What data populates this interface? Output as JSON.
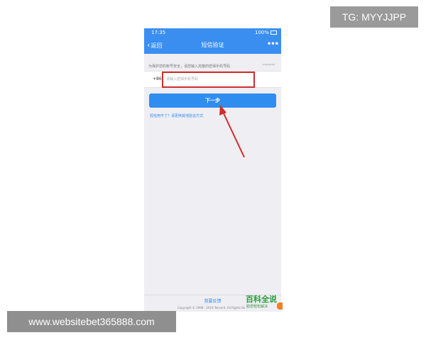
{
  "status_bar": {
    "time": "17:35",
    "right_text": "100%"
  },
  "nav": {
    "back_label": "返回",
    "title": "短信验证",
    "more_label": "•••"
  },
  "tip": {
    "text": "为保护您的帐号安全，请您输入完整的密保手机号码",
    "masked": "*******"
  },
  "phone_row": {
    "country_code": "+86",
    "placeholder": "请输入密保手机号码"
  },
  "next_button": {
    "label": "下一步"
  },
  "alt_link": {
    "label": "短信用不了？请更换其他验证方式"
  },
  "footer": {
    "feedback": "我要反馈",
    "copyright": "Copyright © 1998 - 2019 Tencent. All Rights Re..."
  },
  "overlays": {
    "tg_label": "TG: MYYJJPP",
    "site_label": "www.websitebet365888.com",
    "watermark_title": "百科全说",
    "watermark_sub": "助您轻松解决"
  },
  "colors": {
    "brand_blue": "#3a8ef0",
    "button_blue": "#2f8df0",
    "highlight_red": "#d12c2c",
    "background": "#eeeef3"
  }
}
